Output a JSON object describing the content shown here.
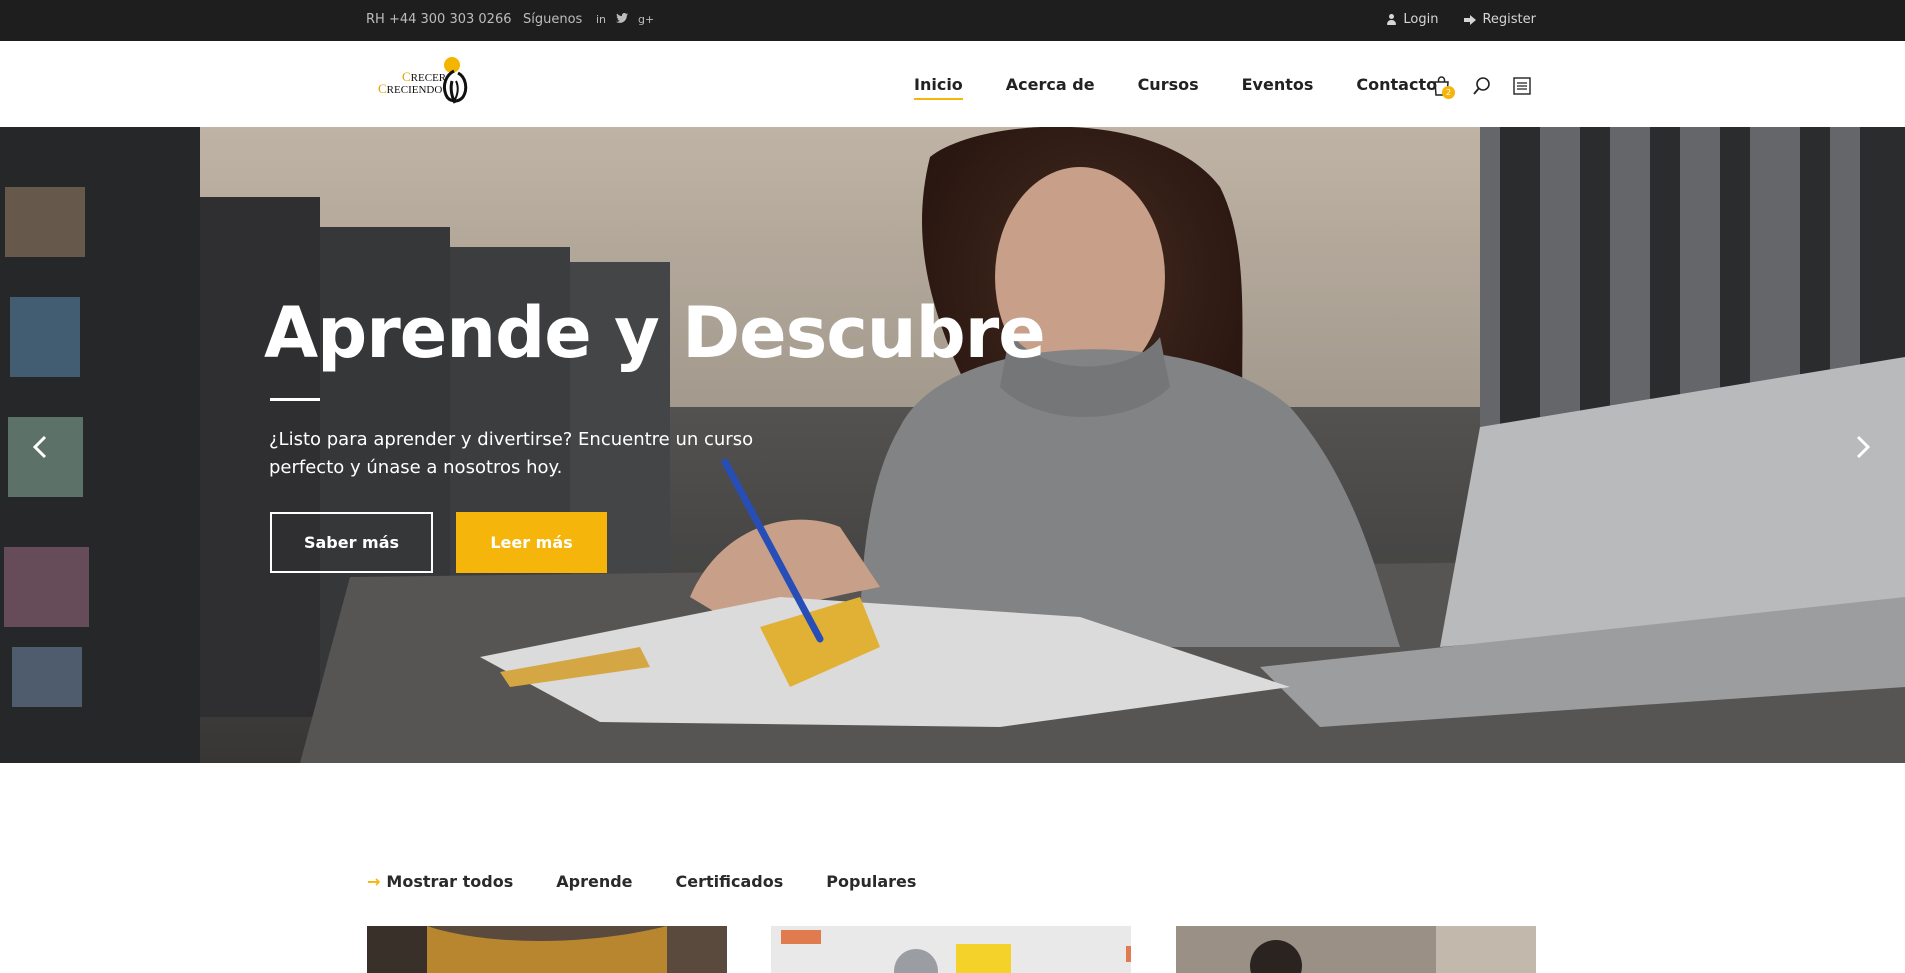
{
  "topbar": {
    "phone": "RH +44 300 303 0266",
    "follow_label": "Síguenos",
    "social": [
      "in",
      "t",
      "g+"
    ],
    "login": "Login",
    "register": "Register"
  },
  "header": {
    "logo_line1_initial": "C",
    "logo_line1_rest": "RECER",
    "logo_line2_initial": "C",
    "logo_line2_rest": "RECIENDO",
    "nav": [
      "Inicio",
      "Acerca de",
      "Cursos",
      "Eventos",
      "Contacto"
    ],
    "active_nav": "Inicio",
    "cart_count": "2",
    "icons": [
      "shopping-bag-icon",
      "search-icon",
      "menu-list-icon"
    ]
  },
  "hero": {
    "title": "Aprende y Descubre",
    "subtitle": "¿Listo para aprender y divertirse? Encuentre un curso perfecto y únase a nosotros hoy.",
    "btn_primary": "Saber más",
    "btn_secondary": "Leer más",
    "accent_color": "#f5b50a"
  },
  "filters": {
    "items": [
      "Mostrar todos",
      "Aprende",
      "Certificados",
      "Populares"
    ],
    "active": "Mostrar todos"
  }
}
